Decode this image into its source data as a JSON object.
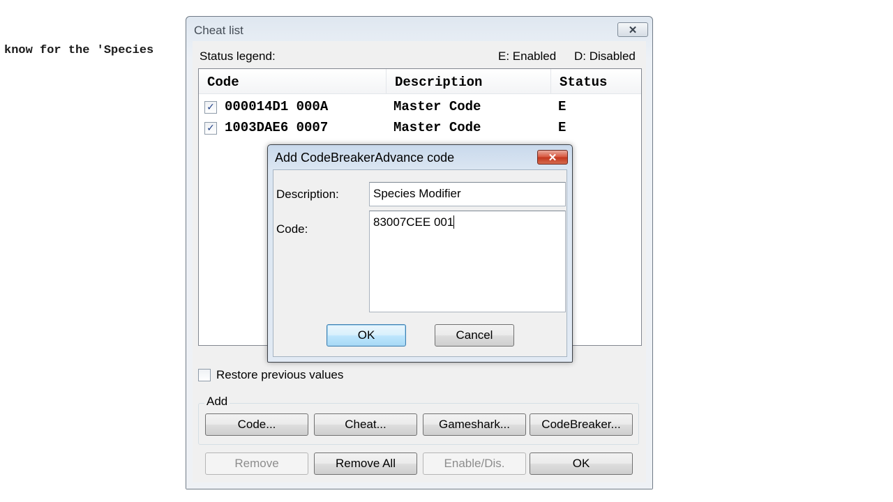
{
  "background_text": "know for the 'Species",
  "main_window": {
    "title": "Cheat list",
    "close_symbol": "✕",
    "status_legend_label": "Status legend:",
    "legend_enabled": "E: Enabled",
    "legend_disabled": "D: Disabled",
    "list": {
      "columns": [
        "Code",
        "Description",
        "Status"
      ],
      "rows": [
        {
          "checked": true,
          "code": "000014D1 000A",
          "description": "Master Code",
          "status": "E"
        },
        {
          "checked": true,
          "code": "1003DAE6 0007",
          "description": "Master Code",
          "status": "E"
        }
      ]
    },
    "restore_label": "Restore previous values",
    "restore_checked": false,
    "add_group_label": "Add",
    "add_buttons": [
      "Code...",
      "Cheat...",
      "Gameshark...",
      "CodeBreaker..."
    ],
    "bottom_buttons": {
      "remove": "Remove",
      "remove_all": "Remove All",
      "enable_dis": "Enable/Dis.",
      "ok": "OK"
    }
  },
  "add_dialog": {
    "title": "Add CodeBreakerAdvance code",
    "close_symbol": "✕",
    "description_label": "Description:",
    "description_value": "Species Modifier",
    "code_label": "Code:",
    "code_value": "83007CEE 001",
    "ok_label": "OK",
    "cancel_label": "Cancel"
  },
  "icons": {
    "checkmark": "✓",
    "close": "close-icon"
  }
}
